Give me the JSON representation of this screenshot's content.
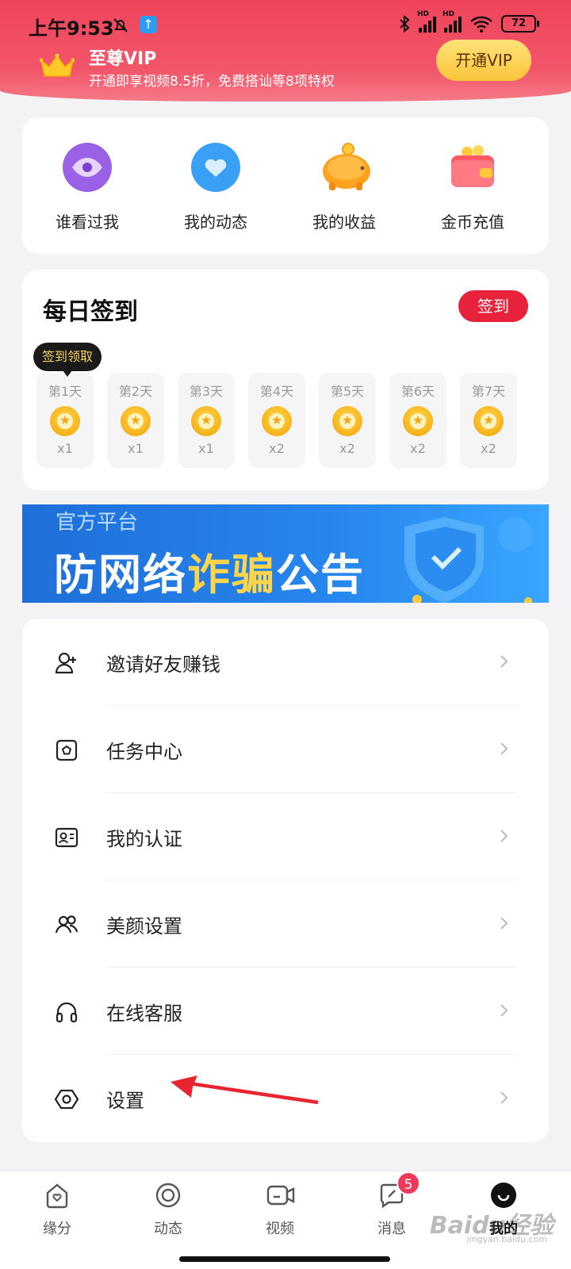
{
  "status_bar": {
    "time": "上午9:53",
    "battery": "72",
    "network_label": "HD"
  },
  "vip": {
    "title": "至尊VIP",
    "subtitle": "开通即享视频8.5折，免费搭讪等8项特权",
    "button": "开通VIP"
  },
  "quick_actions": [
    {
      "label": "谁看过我",
      "icon": "eye-icon"
    },
    {
      "label": "我的动态",
      "icon": "heart-icon"
    },
    {
      "label": "我的收益",
      "icon": "piggy-bank-icon"
    },
    {
      "label": "金币充值",
      "icon": "wallet-icon"
    }
  ],
  "checkin": {
    "title": "每日签到",
    "button": "签到",
    "tooltip": "签到领取",
    "days": [
      {
        "label": "第1天",
        "reward": "x1"
      },
      {
        "label": "第2天",
        "reward": "x1"
      },
      {
        "label": "第3天",
        "reward": "x1"
      },
      {
        "label": "第4天",
        "reward": "x2"
      },
      {
        "label": "第5天",
        "reward": "x2"
      },
      {
        "label": "第6天",
        "reward": "x2"
      },
      {
        "label": "第7天",
        "reward": "x2"
      }
    ]
  },
  "banner": {
    "subtitle": "官方平台",
    "title_part1": "防网络",
    "title_highlight": "诈骗",
    "title_part2": "公告"
  },
  "menu": [
    {
      "label": "邀请好友赚钱",
      "icon": "add-user-icon"
    },
    {
      "label": "任务中心",
      "icon": "task-icon"
    },
    {
      "label": "我的认证",
      "icon": "id-card-icon"
    },
    {
      "label": "美颜设置",
      "icon": "people-icon"
    },
    {
      "label": "在线客服",
      "icon": "headset-icon"
    },
    {
      "label": "设置",
      "icon": "settings-hexagon-icon"
    }
  ],
  "bottom_nav": [
    {
      "label": "缘分",
      "icon": "home-heart-icon"
    },
    {
      "label": "动态",
      "icon": "circle-icon"
    },
    {
      "label": "视频",
      "icon": "video-icon"
    },
    {
      "label": "消息",
      "icon": "message-icon",
      "badge": "5"
    },
    {
      "label": "我的",
      "icon": "profile-icon",
      "active": true
    }
  ],
  "watermark": {
    "text": "Baidu经验",
    "sub": "jingyan.baidu.com"
  },
  "colors": {
    "primary_red": "#e7223a",
    "banner_red": "#f0445a",
    "vip_gold": "#fcc43a",
    "banner_blue": "#1f6fd8"
  }
}
